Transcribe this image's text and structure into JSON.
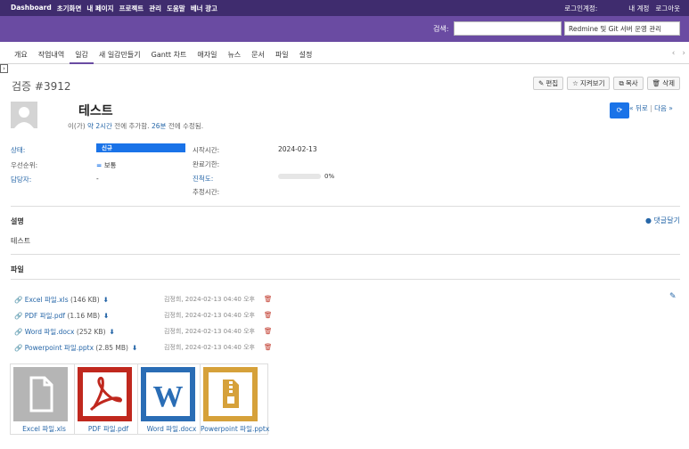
{
  "top_menu": {
    "items": [
      "Dashboard",
      "초기화면",
      "내 페이지",
      "프로젝트",
      "관리",
      "도움말",
      "베너 광고"
    ],
    "login_label": "로그인계정:",
    "my_account": "내 계정",
    "logout": "로그아웃"
  },
  "header": {
    "search_label": "검색:",
    "search_value": "",
    "project_select": "Redmine 및 Git 서버 운영 관리"
  },
  "main_menu": {
    "tabs": [
      "개요",
      "작업내역",
      "일감",
      "새 일감만들기",
      "Gantt 차트",
      "애자일",
      "뉴스",
      "문서",
      "파일",
      "설정"
    ],
    "selected_index": 2,
    "prev_arrow": "‹",
    "next_arrow": "›"
  },
  "issue": {
    "title": "검증 #3912",
    "subject": "테스트",
    "author_line": {
      "prefix": "이(가)",
      "added": "약 2시간",
      "mid": "전에 추가함.",
      "updated": "26분",
      "suffix": "전에 수정됨."
    },
    "prev": "« 뒤로",
    "sep": "|",
    "next": "다음 »"
  },
  "contextual": {
    "edit": "편집",
    "watch": "지켜보기",
    "copy": "복사",
    "delete": "삭제"
  },
  "attributes": {
    "status_label": "상태:",
    "status_value": "신규",
    "priority_label": "우선순위:",
    "priority_value": "보통",
    "assignee_label": "담당자:",
    "assignee_value": "-",
    "start_label": "시작시간:",
    "start_value": "2024-02-13",
    "due_label": "완료기한:",
    "done_label": "진척도:",
    "done_value": "0%",
    "done_fraction": 0,
    "estimated_label": "추정시간:"
  },
  "description": {
    "title": "설명",
    "comment_link": "댓글달기",
    "text": "테스트"
  },
  "files": {
    "title": "파일",
    "list": [
      {
        "name": "Excel 파일.xls",
        "size": "(146 KB)",
        "meta": "김정희, 2024-02-13 04:40 오후"
      },
      {
        "name": "PDF 파일.pdf",
        "size": "(1.16 MB)",
        "meta": "김정희, 2024-02-13 04:40 오후"
      },
      {
        "name": "Word 파일.docx",
        "size": "(252 KB)",
        "meta": "김정희, 2024-02-13 04:40 오후"
      },
      {
        "name": "Powerpoint 파일.pptx",
        "size": "(2.85 MB)",
        "meta": "김정희, 2024-02-13 04:40 오후"
      }
    ],
    "thumbnails": [
      {
        "caption": "Excel 파일.xls",
        "icon": "generic-file-icon",
        "color": "#aaaaaa"
      },
      {
        "caption": "PDF 파일.pdf",
        "icon": "pdf-file-icon",
        "color": "#c0281e"
      },
      {
        "caption": "Word 파일.docx",
        "icon": "word-file-icon",
        "color": "#2a6db5"
      },
      {
        "caption": "Powerpoint 파일.pptx",
        "icon": "archive-file-icon",
        "color": "#d6a13a"
      }
    ]
  },
  "colors": {
    "top_bar": "#3f2c6e",
    "header": "#6a4ba2",
    "link": "#2767a8",
    "status_badge": "#1a73e8"
  }
}
